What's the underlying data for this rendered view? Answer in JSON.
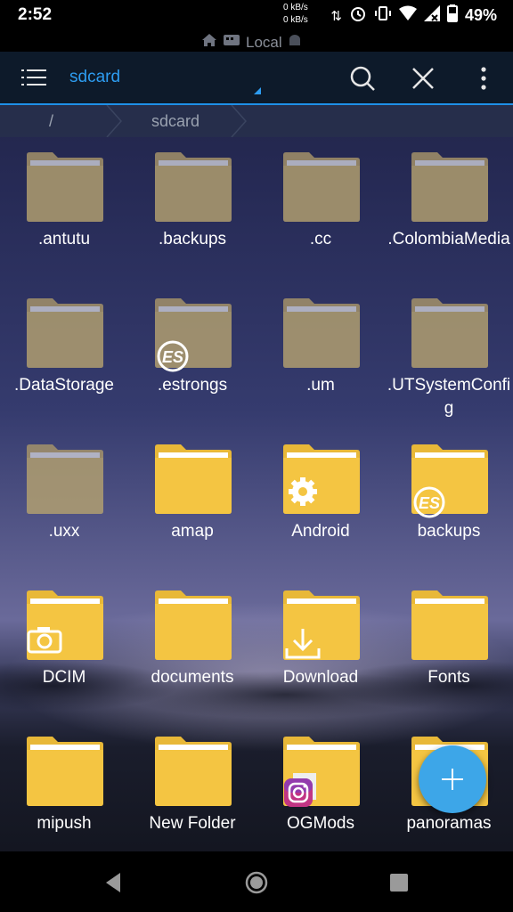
{
  "status_bar": {
    "time": "2:52",
    "net_up": "0 kB/s",
    "net_down": "0 kB/s",
    "battery": "49%"
  },
  "location_bar": {
    "label": "Local"
  },
  "toolbar": {
    "title": "sdcard"
  },
  "breadcrumb": {
    "items": [
      "/",
      "sdcard"
    ]
  },
  "folders": [
    {
      "name": ".antutu",
      "style": "hidden"
    },
    {
      "name": ".backups",
      "style": "hidden"
    },
    {
      "name": ".cc",
      "style": "hidden"
    },
    {
      "name": ".ColombiaMedia",
      "style": "hidden"
    },
    {
      "name": ".DataStorage",
      "style": "hidden"
    },
    {
      "name": ".estrongs",
      "style": "hidden",
      "badge": "es-icon"
    },
    {
      "name": ".um",
      "style": "hidden"
    },
    {
      "name": ".UTSystemConfig",
      "style": "hidden"
    },
    {
      "name": ".uxx",
      "style": "hidden"
    },
    {
      "name": "amap",
      "style": "normal"
    },
    {
      "name": "Android",
      "style": "normal",
      "badge": "gear-icon"
    },
    {
      "name": "backups",
      "style": "normal",
      "badge": "es-icon"
    },
    {
      "name": "DCIM",
      "style": "normal",
      "badge": "camera-icon"
    },
    {
      "name": "documents",
      "style": "normal"
    },
    {
      "name": "Download",
      "style": "normal",
      "badge": "download-icon"
    },
    {
      "name": "Fonts",
      "style": "normal"
    },
    {
      "name": "mipush",
      "style": "normal"
    },
    {
      "name": "New Folder",
      "style": "normal"
    },
    {
      "name": "OGMods",
      "style": "normal",
      "badge": "instagram-icon"
    },
    {
      "name": "panoramas",
      "style": "normal"
    }
  ],
  "colors": {
    "accent": "#2d9cf0",
    "folder_normal": "#f4c542",
    "folder_hidden": "#b5a270",
    "fab": "#3da6e8"
  }
}
